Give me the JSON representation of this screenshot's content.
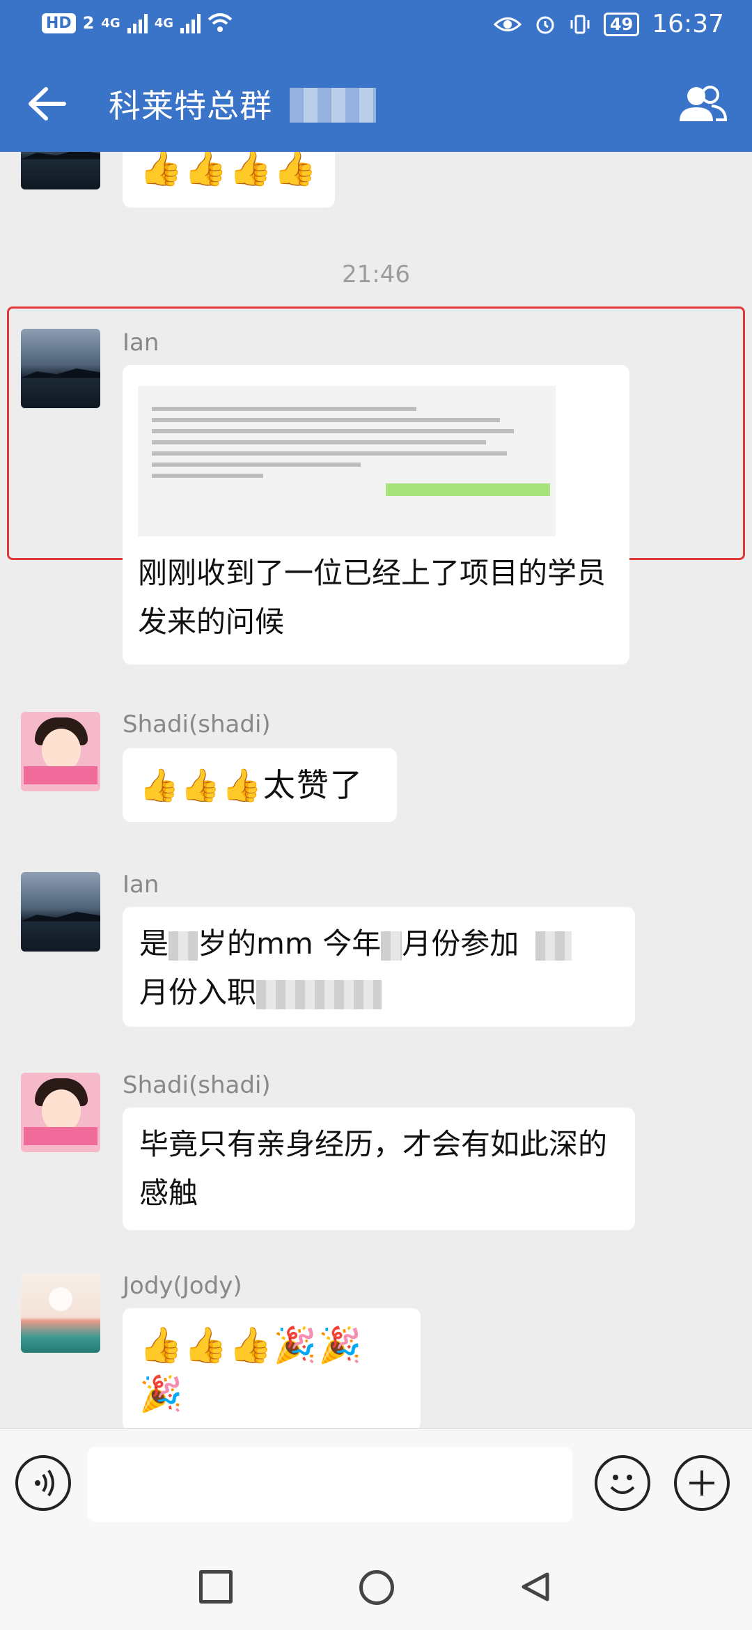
{
  "status_bar": {
    "hd": "HD",
    "sim": "2",
    "net1": "4G",
    "net2": "4G",
    "battery": "49",
    "time": "16:37"
  },
  "header": {
    "title": "科莱特总群"
  },
  "chat": {
    "timestamp": "21:46",
    "messages": [
      {
        "sender": "",
        "content": "👍👍👍👍"
      },
      {
        "sender": "Ian",
        "type": "image",
        "caption": "刚刚收到了一位已经上了项目的学员发来的问候"
      },
      {
        "sender": "Shadi(shadi)",
        "content": "👍👍👍太赞了"
      },
      {
        "sender": "Ian",
        "content_parts": [
          "是",
          "岁的mm  今年",
          "月份参加",
          "月份入职"
        ]
      },
      {
        "sender": "Shadi(shadi)",
        "content": "毕竟只有亲身经历，才会有如此深的感触"
      },
      {
        "sender": "Jody(Jody)",
        "content": "👍👍👍🎉🎉🎉"
      }
    ]
  },
  "input": {
    "placeholder": ""
  },
  "icons": {
    "back": "arrow-left-icon",
    "members": "group-members-icon",
    "voice": "voice-icon",
    "emoji": "smile-icon",
    "more": "plus-icon",
    "nav_recent": "square-icon",
    "nav_home": "circle-icon",
    "nav_back": "triangle-back-icon"
  },
  "colors": {
    "header": "#3a74c8",
    "chat_bg": "#ededed",
    "highlight": "#e23a3a"
  }
}
